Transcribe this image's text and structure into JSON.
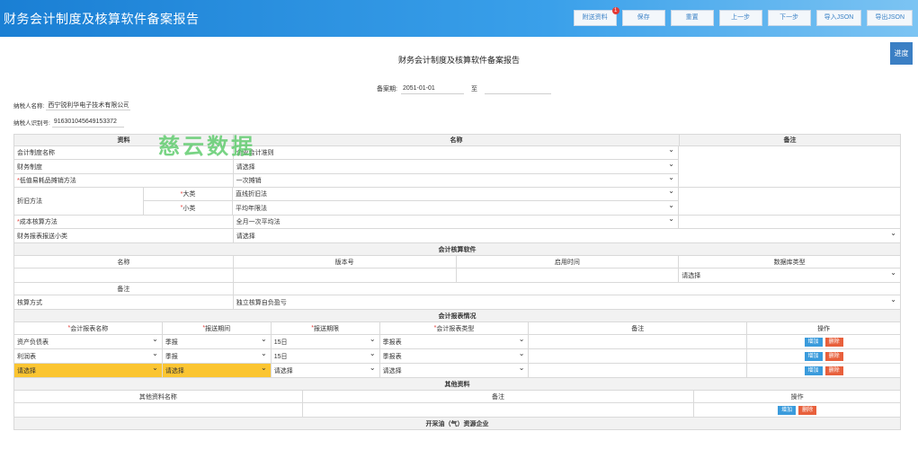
{
  "header": {
    "title": "财务会计制度及核算软件备案报告",
    "buttons": [
      {
        "label": "附送资料",
        "badge": "1"
      },
      {
        "label": "保存"
      },
      {
        "label": "重置"
      },
      {
        "label": "上一步"
      },
      {
        "label": "下一步"
      },
      {
        "label": "导入JSON"
      },
      {
        "label": "导出JSON"
      }
    ]
  },
  "progress_label": "进度",
  "doc_title": "财务会计制度及核算软件备案报告",
  "period": {
    "label": "备案期:",
    "start": "2051-01-01",
    "separator": "至",
    "end": ""
  },
  "taxpayer": {
    "name_label": "纳税人名称:",
    "name_value": "西宁锐利华电子技术有限公司",
    "id_label": "纳税人识别号:",
    "id_value": "916301045649153372"
  },
  "watermark": "慈云数据",
  "main_table": {
    "headers": [
      "资料",
      "名称",
      "备注"
    ],
    "rows": {
      "system_name": {
        "label": "会计制度名称",
        "value": "企业会计准则"
      },
      "accounting_system": {
        "label": "财务制度",
        "value": "请选择"
      },
      "low_value": {
        "label": "低值易耗品摊销方法",
        "value": "一次摊销"
      },
      "depreciation": {
        "label": "折旧方法",
        "major_label": "大类",
        "major_value": "直线折旧法",
        "minor_label": "小类",
        "minor_value": "平均年限法"
      },
      "cost": {
        "label": "成本核算方法",
        "value": "全月一次平均法"
      },
      "report_sub": {
        "label": "财务报表报送小类",
        "value": "请选择"
      }
    }
  },
  "software": {
    "section_title": "会计核算软件",
    "headers": [
      "名称",
      "版本号",
      "启用时间",
      "数据库类型"
    ],
    "db_value": "请选择",
    "remark_label": "备注",
    "method_label": "核算方式",
    "method_value": "独立核算自负盈亏"
  },
  "reports": {
    "section_title": "会计报表情况",
    "headers": [
      "会计报表名称",
      "报送期间",
      "报送期限",
      "会计报表类型",
      "备注",
      "操作"
    ],
    "rows": [
      {
        "name": "资产负债表",
        "period": "季报",
        "deadline": "15日",
        "type": "季报表"
      },
      {
        "name": "利润表",
        "period": "季报",
        "deadline": "15日",
        "type": "季报表"
      },
      {
        "name": "请选择",
        "period": "请选择",
        "deadline": "请选择",
        "type": "请选择"
      }
    ],
    "add_label": "增加",
    "delete_label": "删除"
  },
  "other": {
    "section_title": "其他资料",
    "headers": [
      "其他资料名称",
      "备注",
      "操作"
    ],
    "add_label": "增加",
    "delete_label": "删除"
  },
  "oil": {
    "section_title": "开采油（气）资源企业"
  }
}
